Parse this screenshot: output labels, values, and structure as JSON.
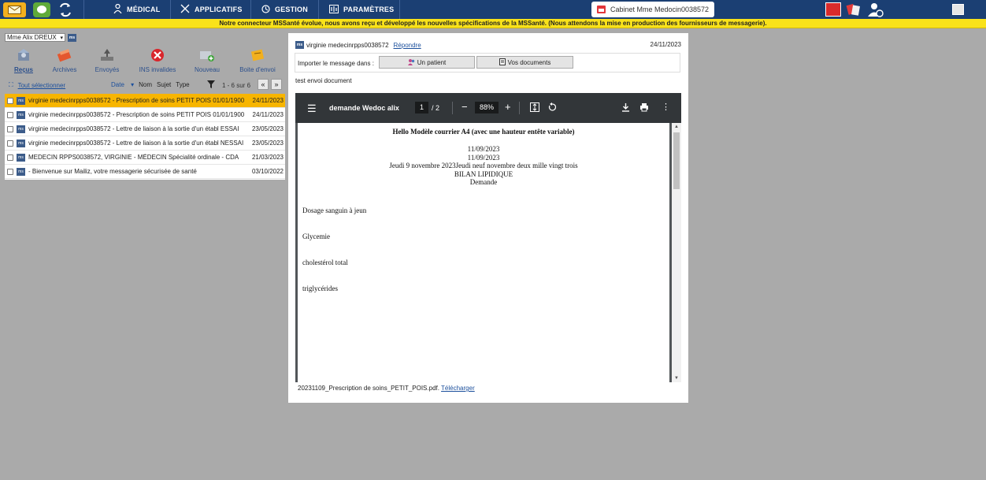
{
  "nav": {
    "items": [
      {
        "label": "MÉDICAL",
        "icon": "stethoscope-icon"
      },
      {
        "label": "APPLICATIFS",
        "icon": "tools-icon"
      },
      {
        "label": "GESTION",
        "icon": "gestion-icon"
      },
      {
        "label": "PARAMÈTRES",
        "icon": "parametres-icon"
      }
    ],
    "cabinet": "Cabinet Mme Medocin0038572"
  },
  "banner": "Notre connecteur MSSanté évolue, nous avons reçu et développé les nouvelles spécifications de la MSSanté. (Nous attendons la mise en production des fournisseurs de messagerie).",
  "account": {
    "selected": "Mme Alix DREUX",
    "badge": "ms"
  },
  "folders": [
    {
      "label": "Reçus",
      "icon": "inbox-icon",
      "active": true
    },
    {
      "label": "Archives",
      "icon": "archive-icon",
      "active": false
    },
    {
      "label": "Envoyés",
      "icon": "sent-icon",
      "active": false
    },
    {
      "label": "INS invalides",
      "icon": "invalid-icon",
      "active": false
    },
    {
      "label": "Nouveau",
      "icon": "new-message-icon",
      "active": false
    },
    {
      "label": "Boite d'envoi",
      "icon": "outbox-icon",
      "active": false
    }
  ],
  "toolbar": {
    "select_all": "Tout sélectionner",
    "sort_date": "Date",
    "sort_nom": "Nom",
    "sort_sujet": "Sujet",
    "sort_type": "Type",
    "pager": "1 - 6 sur 6",
    "prev": "«",
    "next": "»"
  },
  "messages": [
    {
      "subject": "virginie medecinrpps0038572 - Prescription de soins PETIT POIS 01/01/1900",
      "date": "24/11/2023",
      "selected": true
    },
    {
      "subject": "virginie medecinrpps0038572 - Prescription de soins PETIT POIS 01/01/1900",
      "date": "24/11/2023",
      "selected": false
    },
    {
      "subject": "virginie medecinrpps0038572 - Lettre de liaison à la sortie d'un établ ESSAI",
      "date": "23/05/2023",
      "selected": false
    },
    {
      "subject": "virginie medecinrpps0038572 - Lettre de liaison à la sortie d'un établ NESSAI",
      "date": "23/05/2023",
      "selected": false
    },
    {
      "subject": "MEDECIN RPPS0038572, VIRGINIE - MÉDECIN Spécialité ordinale - CDA",
      "date": "21/03/2023",
      "selected": false
    },
    {
      "subject": "- Bienvenue sur Mailiz, votre messagerie sécurisée de santé",
      "date": "03/10/2022",
      "selected": false
    }
  ],
  "viewer": {
    "from": "virginie medecinrpps0038572",
    "reply": "Répondre",
    "date": "24/11/2023",
    "import_label": "Importer le message dans :",
    "btn_patient": "Un patient",
    "btn_docs": "Vos documents",
    "body": "test envoi document",
    "attachment_name": "20231109_Prescription de soins_PETIT_POIS.pdf.",
    "download": "Télécharger"
  },
  "pdf": {
    "title": "demande Wedoc alix",
    "page": "1",
    "pages": "/ 2",
    "zoom": "88%",
    "heading": "Hello Modèle courrier A4 (avec une hauteur entête variable)",
    "date1": "11/09/2023",
    "date2": "11/09/2023",
    "date3": "Jeudi 9 novembre 2023Jeudi neuf novembre deux mille vingt trois",
    "bilan": "BILAN LIPIDIQUE",
    "demande": "Demande",
    "line1": "Dosage sanguin à  jeun",
    "line2": "Glycemie",
    "line3": "cholestérol total",
    "line4": "triglycérides"
  }
}
